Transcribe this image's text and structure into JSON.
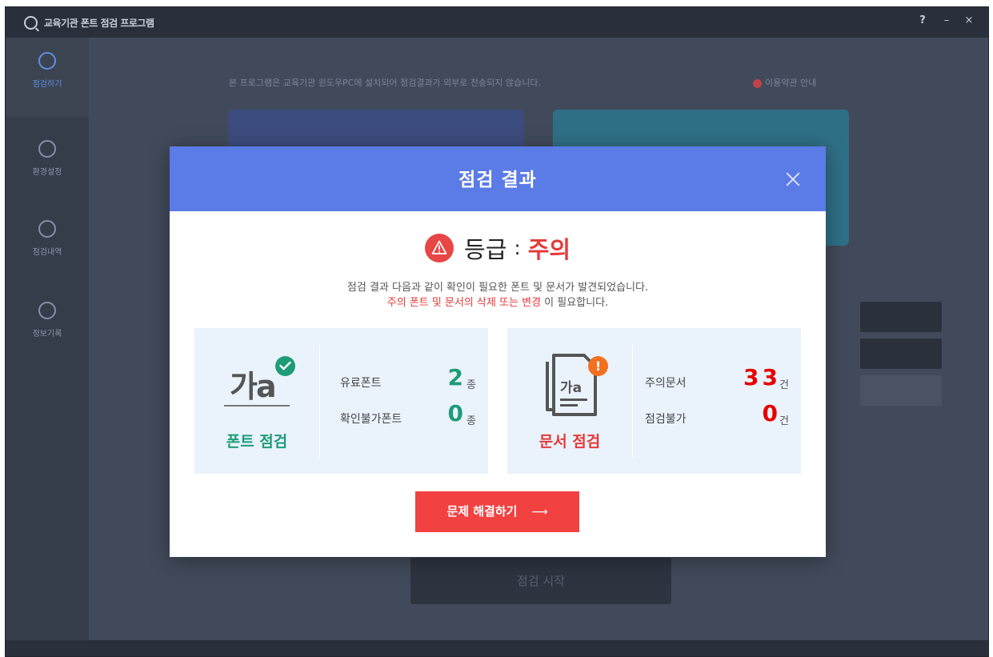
{
  "app": {
    "title": "교육기관 폰트 점검 프로그램",
    "window_buttons": {
      "help": "?",
      "minimize": "–",
      "close": "×"
    }
  },
  "sidebar": {
    "items": [
      {
        "label": "점검하기",
        "icon": "search-icon",
        "active": true
      },
      {
        "label": "환경설정",
        "icon": "gear-icon",
        "active": false
      },
      {
        "label": "점검내역",
        "icon": "eye-icon",
        "active": false
      },
      {
        "label": "정보기록",
        "icon": "chat-icon",
        "active": false
      }
    ]
  },
  "background": {
    "notice": "본 프로그램은 교육기관 윈도우PC에 설치되어 점검결과가 외부로 전송되지 않습니다.",
    "notice_link": "이용약관 안내",
    "start_button": "점검 시작"
  },
  "dialog": {
    "title": "점검 결과",
    "grade_label": "등급",
    "grade_separator": ":",
    "grade_value": "주의",
    "description_line1": "점검 결과 다음과 같이 확인이 필요한 폰트 및 문서가 발견되었습니다.",
    "description_highlight": "주의 폰트 및 문서의 삭제 또는 변경",
    "description_line2_suffix": " 이 필요합니다.",
    "font_panel": {
      "logo_text": "가a",
      "title": "폰트 점검",
      "stats": [
        {
          "label": "유료폰트",
          "value": "2",
          "unit": "종"
        },
        {
          "label": "확인불가폰트",
          "value": "0",
          "unit": "종"
        }
      ]
    },
    "doc_panel": {
      "badge": "!",
      "title": "문서 점검",
      "stats": [
        {
          "label": "주의문서",
          "value": "33",
          "unit": "건"
        },
        {
          "label": "점검불가",
          "value": "0",
          "unit": "건"
        }
      ]
    },
    "action_button": "문제 해결하기",
    "action_arrow": "⟶"
  },
  "colors": {
    "header_blue": "#5b7be6",
    "danger_red": "#e53a3a",
    "success_green": "#1e9c78",
    "panel_bg": "#eaf3fb",
    "action_red": "#f24141",
    "badge_orange": "#f37021"
  }
}
